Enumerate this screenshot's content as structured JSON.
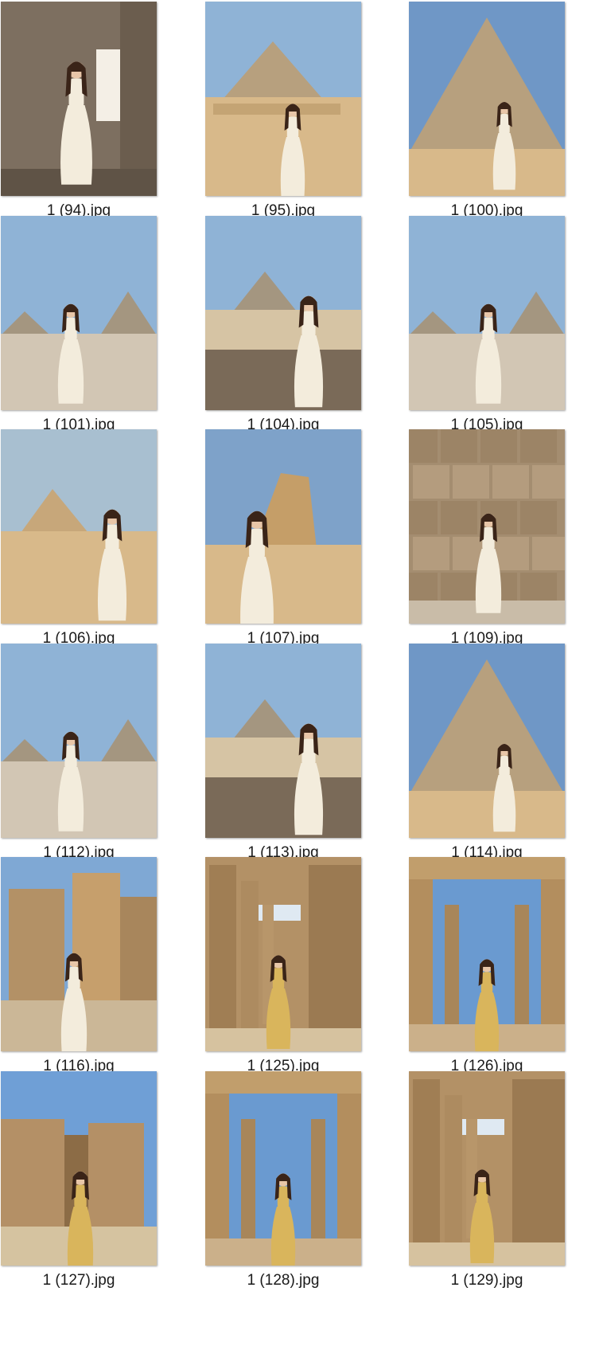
{
  "files": [
    {
      "name": "1 (94).jpg",
      "scene": "temple-interior"
    },
    {
      "name": "1 (95).jpg",
      "scene": "pyramid-distant"
    },
    {
      "name": "1 (100).jpg",
      "scene": "pyramid-large"
    },
    {
      "name": "1 (101).jpg",
      "scene": "two-pyramids"
    },
    {
      "name": "1 (104).jpg",
      "scene": "pyramid-wall"
    },
    {
      "name": "1 (105).jpg",
      "scene": "two-pyramids"
    },
    {
      "name": "1 (106).jpg",
      "scene": "pyramids-desert"
    },
    {
      "name": "1 (107).jpg",
      "scene": "sphinx"
    },
    {
      "name": "1 (109).jpg",
      "scene": "stone-blocks"
    },
    {
      "name": "1 (112).jpg",
      "scene": "two-pyramids"
    },
    {
      "name": "1 (113).jpg",
      "scene": "pyramid-wall"
    },
    {
      "name": "1 (114).jpg",
      "scene": "pyramid-large"
    },
    {
      "name": "1 (116).jpg",
      "scene": "temple-ruins"
    },
    {
      "name": "1 (125).jpg",
      "scene": "colonnade"
    },
    {
      "name": "1 (126).jpg",
      "scene": "kiosk"
    },
    {
      "name": "1 (127).jpg",
      "scene": "pylon"
    },
    {
      "name": "1 (128).jpg",
      "scene": "kiosk"
    },
    {
      "name": "1 (129).jpg",
      "scene": "colonnade"
    }
  ],
  "colors": {
    "sky": "#8fb3d6",
    "sand": "#d8b98a",
    "stone": "#b39166",
    "pyramid": "#b7a07e",
    "dress_white": "#f3ecdc",
    "dress_gold": "#d9b55c",
    "hair": "#3a2418"
  }
}
